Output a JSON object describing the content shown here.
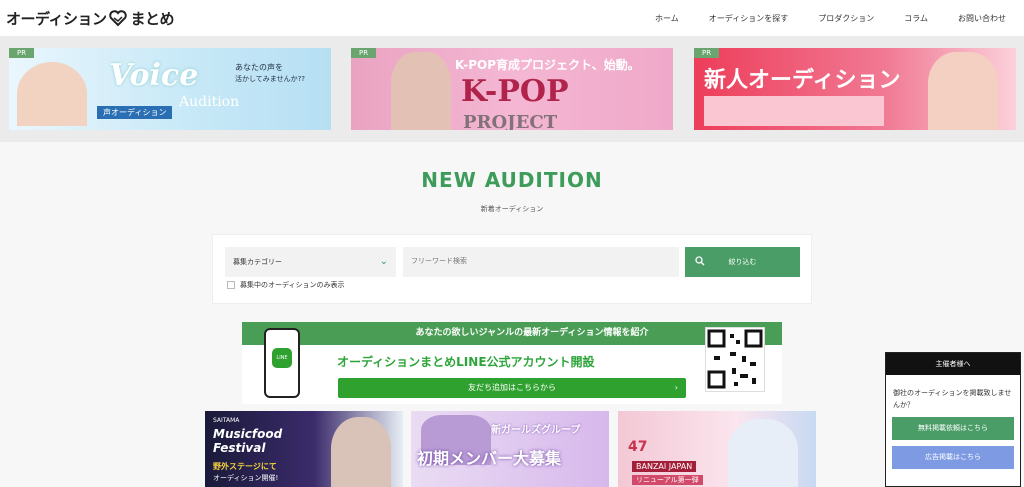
{
  "header": {
    "logo_part1": "オーディション",
    "logo_part2": "まとめ",
    "nav": [
      "ホーム",
      "オーディションを探す",
      "プロダクション",
      "コラム",
      "お問い合わせ"
    ]
  },
  "banners": [
    {
      "pr": "PR",
      "text1": "Voice",
      "text2": "Audition",
      "text3": "あなたの声を",
      "text4": "活かしてみませんか??",
      "text5": "声オーディション"
    },
    {
      "pr": "PR",
      "text1": "K-POP育成プロジェクト、始動。",
      "text2": "K-POP",
      "text3": "PROJECT"
    },
    {
      "pr": "PR",
      "text1": "新人オーディション"
    }
  ],
  "section": {
    "title": "NEW AUDITION",
    "subtitle": "新着オーディション"
  },
  "search": {
    "category": "募集カテゴリー",
    "free_placeholder": "フリーワード検索",
    "button": "絞り込む",
    "checkbox": "募集中のオーディションのみ表示"
  },
  "line_banner": {
    "top": "あなたの欲しいジャンルの最新オーディション情報を紹介",
    "main": "オーディションまとめLINE公式アカウント開設",
    "button": "友だち追加はこちらから",
    "line_label": "LINE"
  },
  "cards": [
    {
      "t1": "SAITAMA",
      "t2": "Musicfood",
      "t3": "Festival",
      "t4": "野外ステージにて",
      "t5": "オーディション開催!"
    },
    {
      "t1": "新ガールズグループ",
      "t2": "初期メンバー大募集"
    },
    {
      "t1": "47",
      "t2": "BANZAI JAPAN",
      "t3": "リニューアル第一弾"
    }
  ],
  "side": {
    "head": "主催者様へ",
    "text": "御社のオーディションを掲載致しませんか？",
    "btn1": "無料掲載依頼はこちら",
    "btn2": "広告掲載はこちら"
  },
  "colors": {
    "accent": "#3e9c5b",
    "line_green": "#2ea12e",
    "blue": "#7d9ae3"
  }
}
